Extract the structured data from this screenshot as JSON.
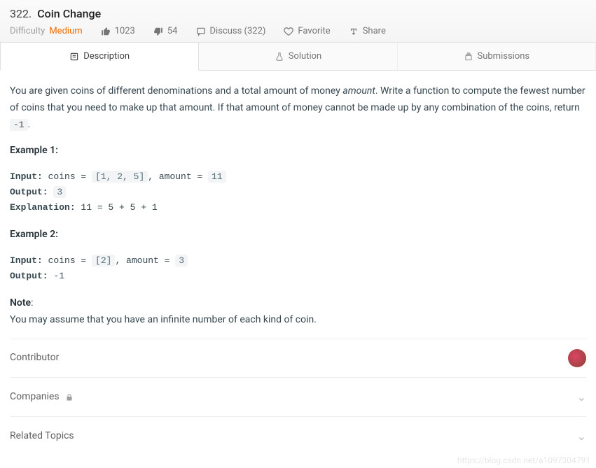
{
  "header": {
    "number": "322.",
    "title": "Coin Change",
    "difficulty_label": "Difficulty",
    "difficulty_value": "Medium",
    "likes": "1023",
    "dislikes": "54",
    "discuss": "Discuss (322)",
    "favorite": "Favorite",
    "share": "Share"
  },
  "tabs": {
    "description": "Description",
    "solution": "Solution",
    "submissions": "Submissions"
  },
  "body": {
    "intro_a": "You are given coins of different denominations and a total amount of money ",
    "intro_em": "amount",
    "intro_b": ". Write a function to compute the fewest number of coins that you need to make up that amount. If that amount of money cannot be made up by any combination of the coins, return ",
    "neg1": "-1",
    "intro_c": ".",
    "example1_h": "Example 1:",
    "ex1_input_label": "Input:",
    "ex1_input_a": " coins = ",
    "ex1_coins": "[1, 2, 5]",
    "ex1_input_b": ", amount = ",
    "ex1_amount": "11",
    "ex1_output_label": "Output:",
    "ex1_output_val": "3",
    "ex1_expl_label": "Explanation:",
    "ex1_expl_val": " 11 = 5 + 5 + 1",
    "example2_h": "Example 2:",
    "ex2_input_label": "Input:",
    "ex2_input_a": " coins = ",
    "ex2_coins": "[2]",
    "ex2_input_b": ", amount = ",
    "ex2_amount": "3",
    "ex2_output_label": "Output:",
    "ex2_output_val": " -1",
    "note_h": "Note",
    "note_body": "You may assume that you have an infinite number of each kind of coin."
  },
  "sections": {
    "contributor": "Contributor",
    "companies": "Companies",
    "related": "Related Topics"
  },
  "watermark": "https://blog.csdn.net/a1097304791"
}
